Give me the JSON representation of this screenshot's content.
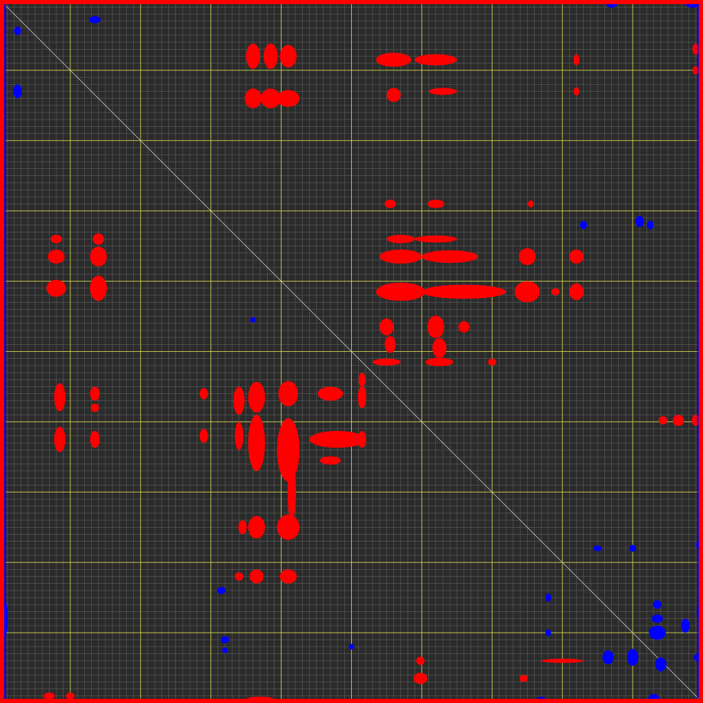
{
  "chart_data": {
    "type": "heatmap",
    "title": "",
    "xlabel": "",
    "ylabel": "",
    "x_range": [
      0,
      1
    ],
    "y_range": [
      0,
      1
    ],
    "grid": "on",
    "minor_grid_divisions": 100,
    "major_grid_divisions": 10,
    "diagonal_line": true,
    "colors": {
      "background": "#2b2b2b",
      "minor_grid": "#8a8a8a",
      "major_grid": "#e6e64a",
      "diagonal": "#c8c8c8",
      "positive": "#ff0000",
      "negative": "#0000ff"
    },
    "positive_blobs": [
      [
        0.36,
        0.08,
        0.01,
        0.018
      ],
      [
        0.36,
        0.14,
        0.012,
        0.014
      ],
      [
        0.385,
        0.08,
        0.01,
        0.018
      ],
      [
        0.385,
        0.14,
        0.014,
        0.014
      ],
      [
        0.41,
        0.08,
        0.012,
        0.016
      ],
      [
        0.41,
        0.14,
        0.016,
        0.012
      ],
      [
        0.56,
        0.085,
        0.025,
        0.01
      ],
      [
        0.62,
        0.085,
        0.03,
        0.008
      ],
      [
        0.56,
        0.135,
        0.01,
        0.01
      ],
      [
        0.63,
        0.13,
        0.02,
        0.005
      ],
      [
        0.08,
        0.365,
        0.012,
        0.01
      ],
      [
        0.08,
        0.41,
        0.014,
        0.012
      ],
      [
        0.14,
        0.365,
        0.012,
        0.014
      ],
      [
        0.14,
        0.41,
        0.012,
        0.018
      ],
      [
        0.08,
        0.34,
        0.008,
        0.006
      ],
      [
        0.14,
        0.34,
        0.008,
        0.008
      ],
      [
        0.57,
        0.365,
        0.03,
        0.01
      ],
      [
        0.64,
        0.365,
        0.04,
        0.009
      ],
      [
        0.57,
        0.415,
        0.035,
        0.013
      ],
      [
        0.66,
        0.415,
        0.06,
        0.01
      ],
      [
        0.75,
        0.415,
        0.018,
        0.015
      ],
      [
        0.75,
        0.365,
        0.012,
        0.012
      ],
      [
        0.82,
        0.365,
        0.01,
        0.01
      ],
      [
        0.82,
        0.415,
        0.01,
        0.012
      ],
      [
        0.57,
        0.34,
        0.02,
        0.006
      ],
      [
        0.62,
        0.34,
        0.03,
        0.005
      ],
      [
        0.55,
        0.465,
        0.01,
        0.012
      ],
      [
        0.555,
        0.49,
        0.008,
        0.012
      ],
      [
        0.62,
        0.465,
        0.012,
        0.016
      ],
      [
        0.625,
        0.495,
        0.01,
        0.014
      ],
      [
        0.55,
        0.515,
        0.02,
        0.005
      ],
      [
        0.625,
        0.515,
        0.02,
        0.006
      ],
      [
        0.66,
        0.465,
        0.008,
        0.008
      ],
      [
        0.085,
        0.565,
        0.008,
        0.02
      ],
      [
        0.085,
        0.625,
        0.008,
        0.018
      ],
      [
        0.135,
        0.56,
        0.007,
        0.01
      ],
      [
        0.135,
        0.625,
        0.007,
        0.012
      ],
      [
        0.135,
        0.58,
        0.006,
        0.006
      ],
      [
        0.29,
        0.56,
        0.006,
        0.008
      ],
      [
        0.29,
        0.62,
        0.006,
        0.01
      ],
      [
        0.34,
        0.57,
        0.008,
        0.02
      ],
      [
        0.365,
        0.565,
        0.012,
        0.022
      ],
      [
        0.365,
        0.63,
        0.012,
        0.04
      ],
      [
        0.41,
        0.56,
        0.014,
        0.018
      ],
      [
        0.41,
        0.64,
        0.016,
        0.045
      ],
      [
        0.34,
        0.62,
        0.006,
        0.02
      ],
      [
        0.47,
        0.56,
        0.018,
        0.01
      ],
      [
        0.48,
        0.625,
        0.04,
        0.012
      ],
      [
        0.47,
        0.655,
        0.015,
        0.006
      ],
      [
        0.515,
        0.54,
        0.005,
        0.01
      ],
      [
        0.515,
        0.565,
        0.006,
        0.016
      ],
      [
        0.515,
        0.625,
        0.006,
        0.012
      ],
      [
        0.345,
        0.75,
        0.006,
        0.01
      ],
      [
        0.365,
        0.75,
        0.012,
        0.016
      ],
      [
        0.41,
        0.75,
        0.016,
        0.018
      ],
      [
        0.365,
        0.82,
        0.01,
        0.01
      ],
      [
        0.41,
        0.82,
        0.012,
        0.01
      ],
      [
        0.34,
        0.82,
        0.006,
        0.006
      ],
      [
        0.415,
        0.7,
        0.006,
        0.04
      ],
      [
        0.943,
        0.598,
        0.006,
        0.006
      ],
      [
        0.965,
        0.598,
        0.008,
        0.008
      ],
      [
        0.99,
        0.598,
        0.006,
        0.008
      ],
      [
        0.598,
        0.965,
        0.01,
        0.008
      ],
      [
        0.598,
        0.94,
        0.006,
        0.006
      ],
      [
        0.07,
        0.99,
        0.008,
        0.005
      ],
      [
        0.1,
        0.99,
        0.006,
        0.005
      ],
      [
        0.37,
        0.995,
        0.02,
        0.004
      ],
      [
        0.99,
        0.07,
        0.005,
        0.008
      ],
      [
        0.99,
        0.1,
        0.005,
        0.006
      ],
      [
        0.82,
        0.085,
        0.004,
        0.008
      ],
      [
        0.82,
        0.13,
        0.004,
        0.006
      ],
      [
        0.555,
        0.29,
        0.008,
        0.006
      ],
      [
        0.62,
        0.29,
        0.012,
        0.006
      ],
      [
        0.755,
        0.29,
        0.004,
        0.005
      ],
      [
        0.7,
        0.515,
        0.006,
        0.005
      ],
      [
        0.79,
        0.415,
        0.006,
        0.005
      ],
      [
        0.8,
        0.94,
        0.03,
        0.003
      ],
      [
        0.745,
        0.965,
        0.006,
        0.005
      ]
    ],
    "negative_blobs": [
      [
        0.985,
        0.005,
        0.01,
        0.006
      ],
      [
        0.87,
        0.005,
        0.008,
        0.006
      ],
      [
        0.135,
        0.028,
        0.008,
        0.005
      ],
      [
        0.025,
        0.13,
        0.006,
        0.01
      ],
      [
        0.025,
        0.044,
        0.005,
        0.006
      ],
      [
        0.91,
        0.315,
        0.006,
        0.008
      ],
      [
        0.925,
        0.32,
        0.005,
        0.006
      ],
      [
        1.0,
        0.32,
        0.005,
        0.008
      ],
      [
        0.83,
        0.32,
        0.005,
        0.006
      ],
      [
        0.005,
        0.88,
        0.006,
        0.03
      ],
      [
        0.005,
        0.76,
        0.004,
        0.01
      ],
      [
        0.315,
        0.84,
        0.006,
        0.005
      ],
      [
        0.32,
        0.91,
        0.006,
        0.005
      ],
      [
        0.32,
        0.925,
        0.004,
        0.004
      ],
      [
        0.865,
        0.935,
        0.008,
        0.01
      ],
      [
        0.9,
        0.935,
        0.008,
        0.012
      ],
      [
        0.935,
        0.9,
        0.012,
        0.01
      ],
      [
        0.935,
        0.88,
        0.008,
        0.006
      ],
      [
        0.94,
        0.945,
        0.008,
        0.01
      ],
      [
        0.995,
        0.935,
        0.008,
        0.006
      ],
      [
        0.93,
        0.995,
        0.008,
        0.008
      ],
      [
        0.88,
        1.0,
        0.015,
        0.006
      ],
      [
        0.935,
        0.86,
        0.006,
        0.006
      ],
      [
        0.975,
        0.89,
        0.006,
        0.01
      ],
      [
        0.995,
        0.87,
        0.004,
        0.008
      ],
      [
        0.9,
        0.78,
        0.005,
        0.005
      ],
      [
        0.995,
        0.775,
        0.005,
        0.006
      ],
      [
        0.85,
        0.78,
        0.006,
        0.004
      ],
      [
        0.78,
        0.85,
        0.004,
        0.006
      ],
      [
        0.78,
        0.9,
        0.004,
        0.005
      ],
      [
        0.77,
        0.995,
        0.006,
        0.004
      ],
      [
        0.32,
        1.0,
        0.01,
        0.005
      ],
      [
        0.36,
        0.455,
        0.004,
        0.004
      ],
      [
        0.5,
        0.92,
        0.004,
        0.004
      ]
    ]
  }
}
